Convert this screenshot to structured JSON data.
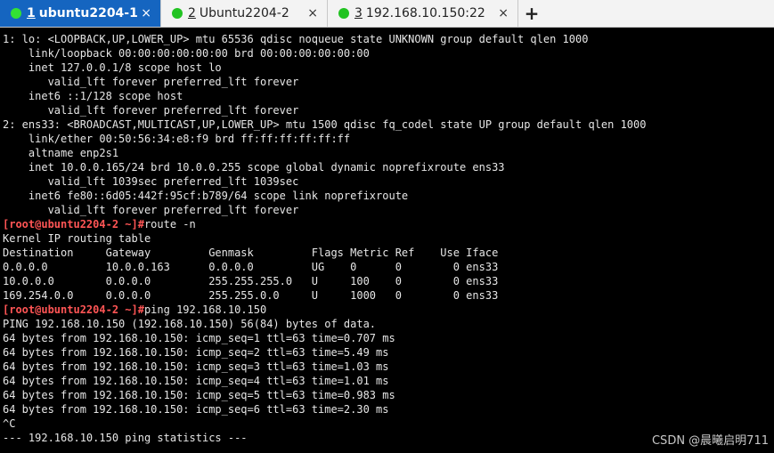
{
  "tabs": [
    {
      "num": "1",
      "title": "ubuntu2204-1",
      "close": "×"
    },
    {
      "num": "2",
      "title": "Ubuntu2204-2",
      "close": "×"
    },
    {
      "num": "3",
      "title": "192.168.10.150:22",
      "close": "×"
    }
  ],
  "new_tab_label": "+",
  "colors": {
    "active_tab": "#1565c0",
    "status_dot": "#22c322",
    "prompt": "#ff5555"
  },
  "terminal": {
    "lines": [
      "1: lo: <LOOPBACK,UP,LOWER_UP> mtu 65536 qdisc noqueue state UNKNOWN group default qlen 1000",
      "    link/loopback 00:00:00:00:00:00 brd 00:00:00:00:00:00",
      "    inet 127.0.0.1/8 scope host lo",
      "       valid_lft forever preferred_lft forever",
      "    inet6 ::1/128 scope host",
      "       valid_lft forever preferred_lft forever",
      "2: ens33: <BROADCAST,MULTICAST,UP,LOWER_UP> mtu 1500 qdisc fq_codel state UP group default qlen 1000",
      "    link/ether 00:50:56:34:e8:f9 brd ff:ff:ff:ff:ff:ff",
      "    altname enp2s1",
      "    inet 10.0.0.165/24 brd 10.0.0.255 scope global dynamic noprefixroute ens33",
      "       valid_lft 1039sec preferred_lft 1039sec",
      "    inet6 fe80::6d05:442f:95cf:b789/64 scope link noprefixroute",
      "       valid_lft forever preferred_lft forever",
      {
        "prompt": "[root@ubuntu2204-2 ~]#",
        "cmd": "route -n"
      },
      "Kernel IP routing table",
      "Destination     Gateway         Genmask         Flags Metric Ref    Use Iface",
      "0.0.0.0         10.0.0.163      0.0.0.0         UG    0      0        0 ens33",
      "10.0.0.0        0.0.0.0         255.255.255.0   U     100    0        0 ens33",
      "169.254.0.0     0.0.0.0         255.255.0.0     U     1000   0        0 ens33",
      {
        "prompt": "[root@ubuntu2204-2 ~]#",
        "cmd": "ping 192.168.10.150"
      },
      "PING 192.168.10.150 (192.168.10.150) 56(84) bytes of data.",
      "64 bytes from 192.168.10.150: icmp_seq=1 ttl=63 time=0.707 ms",
      "64 bytes from 192.168.10.150: icmp_seq=2 ttl=63 time=5.49 ms",
      "64 bytes from 192.168.10.150: icmp_seq=3 ttl=63 time=1.03 ms",
      "64 bytes from 192.168.10.150: icmp_seq=4 ttl=63 time=1.01 ms",
      "64 bytes from 192.168.10.150: icmp_seq=5 ttl=63 time=0.983 ms",
      "64 bytes from 192.168.10.150: icmp_seq=6 ttl=63 time=2.30 ms",
      "^C",
      "--- 192.168.10.150 ping statistics ---"
    ]
  },
  "watermark": "CSDN @晨曦启明711"
}
